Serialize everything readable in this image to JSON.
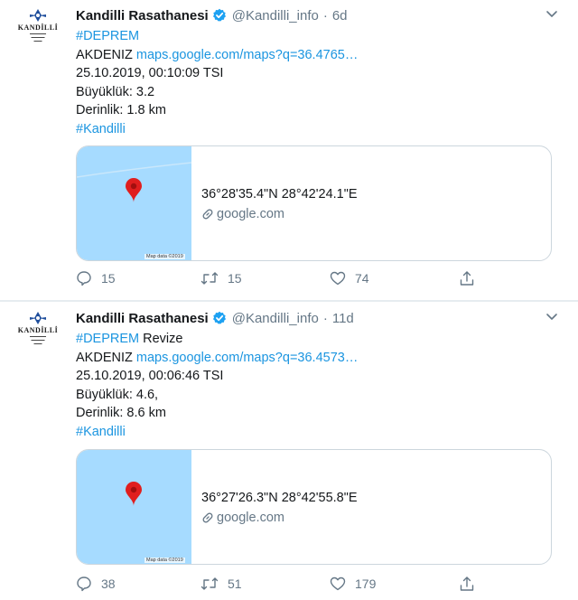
{
  "colors": {
    "accent": "#1b95e0",
    "muted": "#657786",
    "map_water": "#a6dbff",
    "pin": "#e01e1e",
    "verified": "#1da1f2"
  },
  "tweets": [
    {
      "avatar_text": "KANDİLLİ",
      "name": "Kandilli Rasathanesi",
      "handle": "@Kandilli_info",
      "separator": "·",
      "time": "6d",
      "lines": [
        {
          "hashtag": "#DEPREM",
          "text": ""
        },
        {
          "text": "AKDENIZ ",
          "link": "maps.google.com/maps?q=36.4765…"
        },
        {
          "text": "25.10.2019, 00:10:09 TSI"
        },
        {
          "text": "Büyüklük: 3.2"
        },
        {
          "text": "Derinlik: 1.8 km"
        },
        {
          "hashtag": "#Kandilli"
        }
      ],
      "card": {
        "title": "36°28'35.4\"N 28°42'24.1\"E",
        "domain": "google.com",
        "map_credit": "Map data ©2019"
      },
      "actions": {
        "replies": "15",
        "retweets": "15",
        "likes": "74"
      }
    },
    {
      "avatar_text": "KANDİLLİ",
      "name": "Kandilli Rasathanesi",
      "handle": "@Kandilli_info",
      "separator": "·",
      "time": "11d",
      "lines": [
        {
          "hashtag": "#DEPREM",
          "text": " Revize"
        },
        {
          "text": "AKDENIZ ",
          "link": "maps.google.com/maps?q=36.4573…"
        },
        {
          "text": "25.10.2019, 00:06:46 TSI"
        },
        {
          "text": "Büyüklük: 4.6,"
        },
        {
          "text": "Derinlik: 8.6 km"
        },
        {
          "hashtag": "#Kandilli"
        }
      ],
      "card": {
        "title": "36°27'26.3\"N 28°42'55.8\"E",
        "domain": "google.com",
        "map_credit": "Map data ©2019"
      },
      "actions": {
        "replies": "38",
        "retweets": "51",
        "likes": "179"
      }
    }
  ]
}
